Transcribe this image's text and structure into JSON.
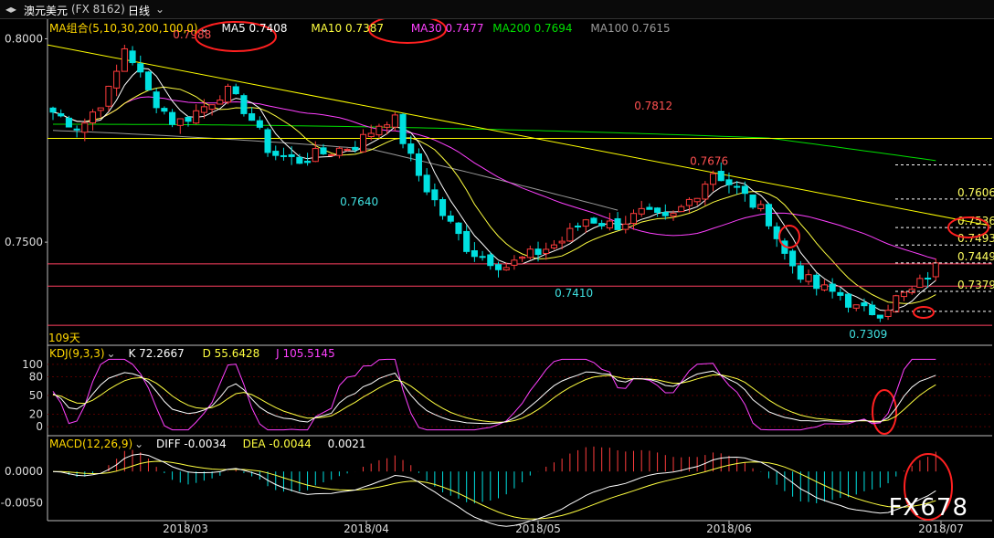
{
  "header": {
    "title": "澳元美元",
    "code": "(FX 8162)",
    "period": "日线",
    "dropdown_icon": "chevron-down-icon"
  },
  "ma_legend": {
    "group_label": "MA组合(5,10,30,200,100,0)",
    "ma5": "MA5 0.7408",
    "ma10": "MA10 0.7387",
    "ma30": "MA30 0.7477",
    "ma200": "MA200 0.7694",
    "ma100": "MA100 0.7615"
  },
  "kdj_legend": {
    "label": "KDJ(9,3,3)",
    "k": "K 72.2667",
    "d": "D 55.6428",
    "j": "J 105.5145"
  },
  "macd_legend": {
    "label": "MACD(12,26,9)",
    "diff": "DIFF -0.0034",
    "dea": "DEA -0.0044",
    "macd": "0.0021"
  },
  "days_label": "109天",
  "watermark": "FX678",
  "colors": {
    "up": "#ff3c3c",
    "down": "#00e0e0",
    "ma5": "#ffffff",
    "ma10": "#ffff40",
    "ma30": "#ff40ff",
    "ma200": "#00e000",
    "ma100": "#9a9a9a",
    "trend": "#ffff00",
    "level": "#ff4060",
    "annot": "#ff2020"
  },
  "chart_data": {
    "type": "candlestick",
    "main_axis": {
      "ylim": [
        0.726,
        0.801
      ],
      "ticks": [
        "0.8000",
        "0.7500"
      ]
    },
    "x_labels": [
      "2018/03",
      "2018/04",
      "2018/05",
      "2018/06",
      "2018/07"
    ],
    "price_labels": [
      {
        "text": "0.7988",
        "value": 0.7988,
        "kind": "high"
      },
      {
        "text": "0.7812",
        "value": 0.7812,
        "kind": "high"
      },
      {
        "text": "0.7676",
        "value": 0.7676,
        "kind": "high"
      },
      {
        "text": "0.7640",
        "value": 0.764,
        "kind": "low"
      },
      {
        "text": "0.7410",
        "value": 0.741,
        "kind": "low"
      },
      {
        "text": "0.7309",
        "value": 0.7309,
        "kind": "low"
      }
    ],
    "levels": [
      {
        "text": "0.7606",
        "value": 0.7606
      },
      {
        "text": "0.7536",
        "value": 0.7536
      },
      {
        "text": "0.7493",
        "value": 0.7493
      },
      {
        "text": "0.7449",
        "value": 0.7449
      },
      {
        "text": "0.7379",
        "value": 0.7379
      }
    ],
    "kdj_axis": {
      "ylim": [
        -10,
        110
      ],
      "ticks": [
        "100",
        "80",
        "50",
        "20",
        "0"
      ]
    },
    "macd_axis": {
      "ylim": [
        -0.0075,
        0.0035
      ],
      "ticks": [
        "0.0000",
        "-0.0050"
      ]
    }
  }
}
